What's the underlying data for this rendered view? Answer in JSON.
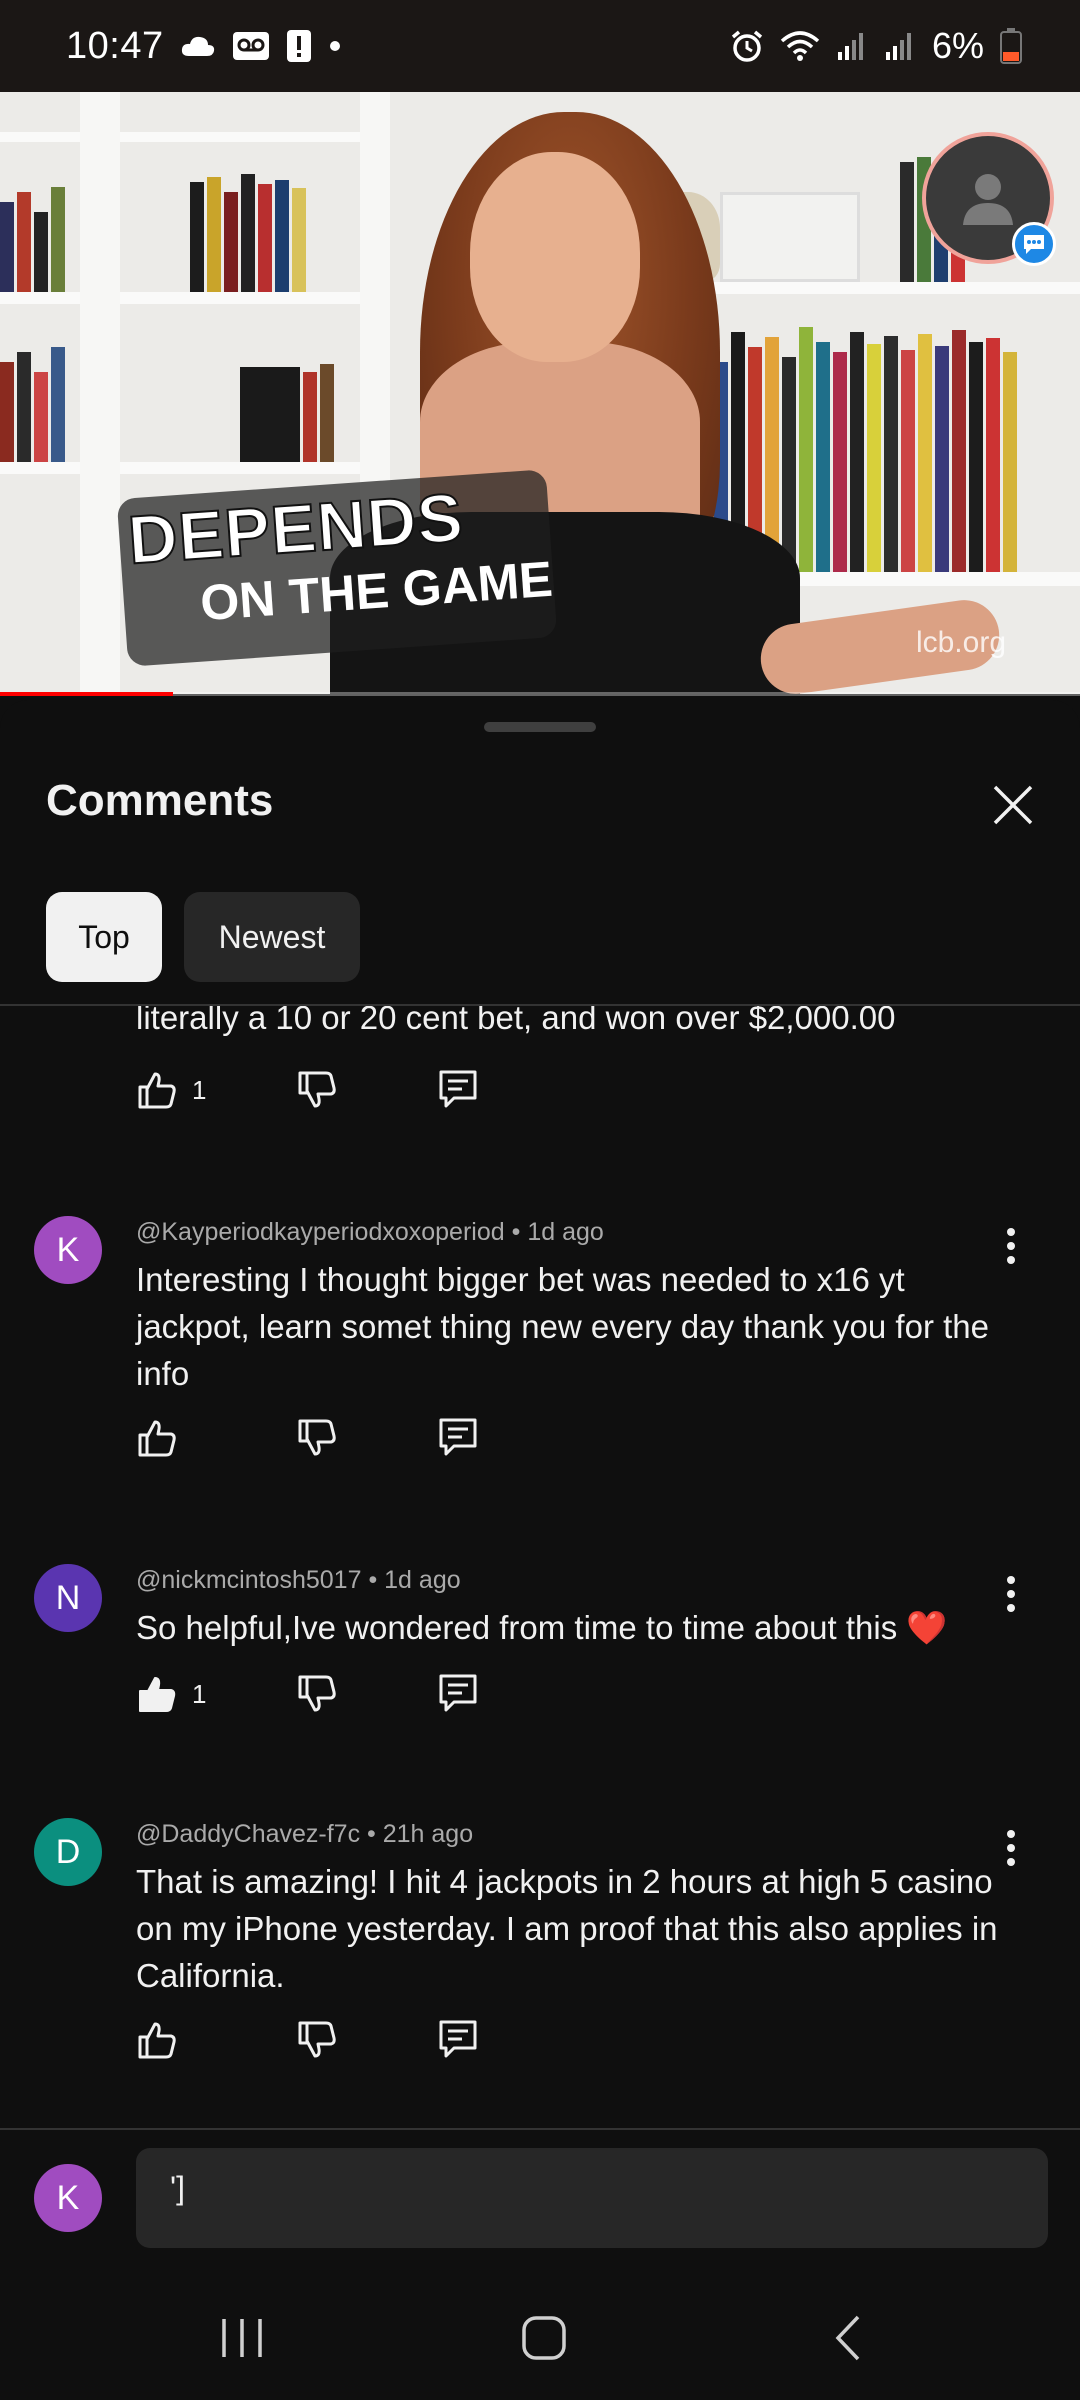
{
  "status_bar": {
    "time": "10:47",
    "battery_percent": "6%",
    "left_icons": [
      "cloud-icon",
      "voicemail-icon",
      "alert-icon",
      "dot-icon"
    ],
    "right_icons": [
      "alarm-icon",
      "wifi-icon",
      "signal-icon",
      "signal-icon",
      "battery-icon"
    ]
  },
  "video": {
    "caption_line1": "DEPENDS",
    "caption_line2": "ON THE GAME",
    "watermark": "lcb.org",
    "progress": 0.16
  },
  "comments_panel": {
    "title": "Comments",
    "tabs": [
      {
        "label": "Top",
        "selected": true
      },
      {
        "label": "Newest",
        "selected": false
      }
    ],
    "partial_comment": {
      "text": "literally a 10 or 20 cent bet, and won over $2,000.00",
      "likes": "1"
    },
    "comments": [
      {
        "avatar_letter": "K",
        "avatar_color": "#a04cc0",
        "author": "@Kayperiodkayperiodxoxoperiod",
        "time": "1d ago",
        "text": "Interesting I thought bigger bet was needed to  x16 yt jackpot,  learn somet thing new every day thank you for the info",
        "likes": "",
        "liked": false
      },
      {
        "avatar_letter": "N",
        "avatar_color": "#5a35b0",
        "author": "@nickmcintosh5017",
        "time": "1d ago",
        "text": "So helpful,Ive wondered from time to time about this ❤️",
        "likes": "1",
        "liked": true
      },
      {
        "avatar_letter": "D",
        "avatar_color": "#0b8f7f",
        "author": "@DaddyChavez-f7c",
        "time": "21h ago",
        "text": "That is amazing! I hit 4 jackpots in 2 hours at high 5 casino on my iPhone yesterday. I am proof that this also applies in California.",
        "likes": "",
        "liked": false
      }
    ]
  },
  "comment_input": {
    "avatar_letter": "K",
    "value": "']"
  },
  "colors": {
    "background": "#0f0f0f",
    "chip_selected": "#f1f1f1",
    "chip_unselected": "#272727",
    "secondary_text": "#aaaaaa",
    "progress": "#ff0000"
  }
}
